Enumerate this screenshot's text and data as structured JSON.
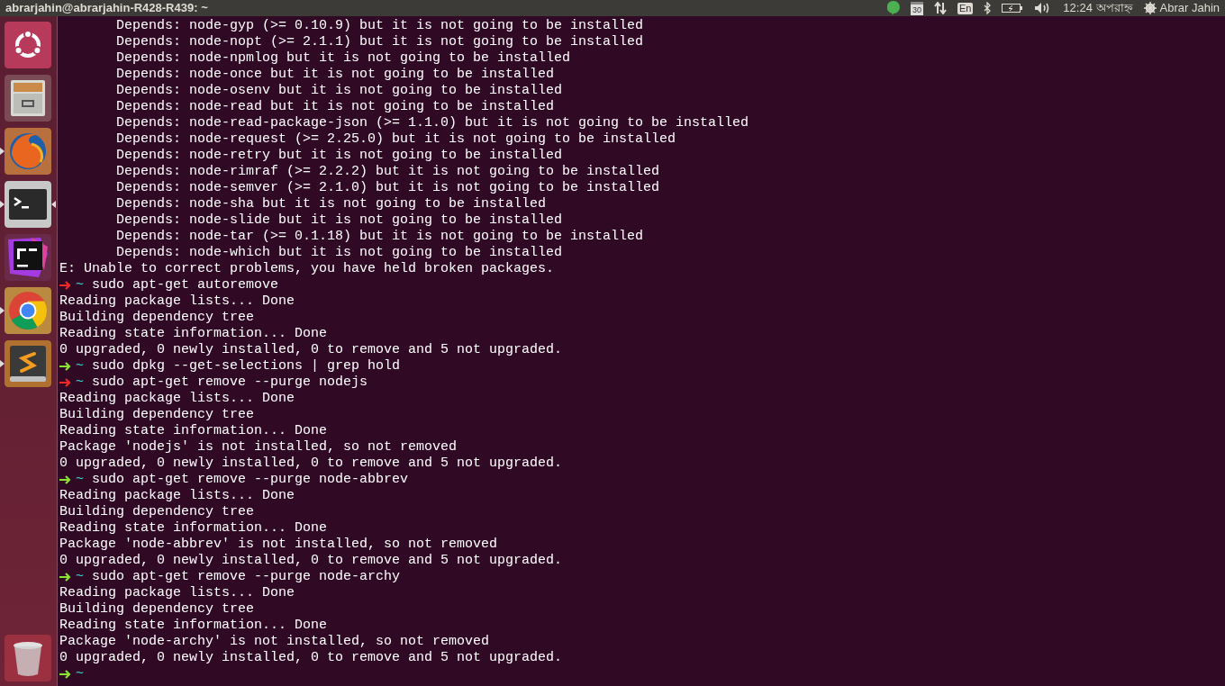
{
  "top_bar": {
    "window_title": "abrarjahin@abrarjahin-R428-R439: ~",
    "calendar_day": "30",
    "keyboard_layout": "En",
    "clock": "12:24 অপরাহ্ন",
    "user_name": "Abrar Jahin"
  },
  "launcher": [
    {
      "kind": "ubuntu",
      "running": false,
      "focused": false
    },
    {
      "kind": "files",
      "running": false,
      "focused": false
    },
    {
      "kind": "firefox",
      "running": true,
      "focused": false
    },
    {
      "kind": "terminal",
      "running": true,
      "focused": true
    },
    {
      "kind": "phpstorm",
      "running": false,
      "focused": false
    },
    {
      "kind": "chrome",
      "running": true,
      "focused": false
    },
    {
      "kind": "sublime",
      "running": true,
      "focused": false
    }
  ],
  "launcher_bottom": [
    {
      "kind": "trash",
      "running": false,
      "focused": false
    }
  ],
  "terminal": [
    {
      "kind": "indented",
      "text": "Depends: node-gyp (>= 0.10.9) but it is not going to be installed"
    },
    {
      "kind": "indented",
      "text": "Depends: node-nopt (>= 2.1.1) but it is not going to be installed"
    },
    {
      "kind": "indented",
      "text": "Depends: node-npmlog but it is not going to be installed"
    },
    {
      "kind": "indented",
      "text": "Depends: node-once but it is not going to be installed"
    },
    {
      "kind": "indented",
      "text": "Depends: node-osenv but it is not going to be installed"
    },
    {
      "kind": "indented",
      "text": "Depends: node-read but it is not going to be installed"
    },
    {
      "kind": "indented",
      "text": "Depends: node-read-package-json (>= 1.1.0) but it is not going to be installed"
    },
    {
      "kind": "indented",
      "text": "Depends: node-request (>= 2.25.0) but it is not going to be installed"
    },
    {
      "kind": "indented",
      "text": "Depends: node-retry but it is not going to be installed"
    },
    {
      "kind": "indented",
      "text": "Depends: node-rimraf (>= 2.2.2) but it is not going to be installed"
    },
    {
      "kind": "indented",
      "text": "Depends: node-semver (>= 2.1.0) but it is not going to be installed"
    },
    {
      "kind": "indented",
      "text": "Depends: node-sha but it is not going to be installed"
    },
    {
      "kind": "indented",
      "text": "Depends: node-slide but it is not going to be installed"
    },
    {
      "kind": "indented",
      "text": "Depends: node-tar (>= 0.1.18) but it is not going to be installed"
    },
    {
      "kind": "indented",
      "text": "Depends: node-which but it is not going to be installed"
    },
    {
      "kind": "output",
      "text": "E: Unable to correct problems, you have held broken packages."
    },
    {
      "kind": "prompt",
      "ok": false,
      "dir": "~",
      "command": "sudo apt-get autoremove"
    },
    {
      "kind": "output",
      "text": "Reading package lists... Done"
    },
    {
      "kind": "output",
      "text": "Building dependency tree"
    },
    {
      "kind": "output",
      "text": "Reading state information... Done"
    },
    {
      "kind": "output",
      "text": "0 upgraded, 0 newly installed, 0 to remove and 5 not upgraded."
    },
    {
      "kind": "prompt",
      "ok": true,
      "dir": "~",
      "command": "sudo dpkg --get-selections | grep hold"
    },
    {
      "kind": "prompt",
      "ok": false,
      "dir": "~",
      "command": "sudo apt-get remove --purge nodejs"
    },
    {
      "kind": "output",
      "text": "Reading package lists... Done"
    },
    {
      "kind": "output",
      "text": "Building dependency tree"
    },
    {
      "kind": "output",
      "text": "Reading state information... Done"
    },
    {
      "kind": "output",
      "text": "Package 'nodejs' is not installed, so not removed"
    },
    {
      "kind": "output",
      "text": "0 upgraded, 0 newly installed, 0 to remove and 5 not upgraded."
    },
    {
      "kind": "prompt",
      "ok": true,
      "dir": "~",
      "command": "sudo apt-get remove --purge node-abbrev"
    },
    {
      "kind": "output",
      "text": "Reading package lists... Done"
    },
    {
      "kind": "output",
      "text": "Building dependency tree"
    },
    {
      "kind": "output",
      "text": "Reading state information... Done"
    },
    {
      "kind": "output",
      "text": "Package 'node-abbrev' is not installed, so not removed"
    },
    {
      "kind": "output",
      "text": "0 upgraded, 0 newly installed, 0 to remove and 5 not upgraded."
    },
    {
      "kind": "prompt",
      "ok": true,
      "dir": "~",
      "command": "sudo apt-get remove --purge node-archy"
    },
    {
      "kind": "output",
      "text": "Reading package lists... Done"
    },
    {
      "kind": "output",
      "text": "Building dependency tree"
    },
    {
      "kind": "output",
      "text": "Reading state information... Done"
    },
    {
      "kind": "output",
      "text": "Package 'node-archy' is not installed, so not removed"
    },
    {
      "kind": "output",
      "text": "0 upgraded, 0 newly installed, 0 to remove and 5 not upgraded."
    },
    {
      "kind": "prompt",
      "ok": true,
      "dir": "~"
    }
  ]
}
